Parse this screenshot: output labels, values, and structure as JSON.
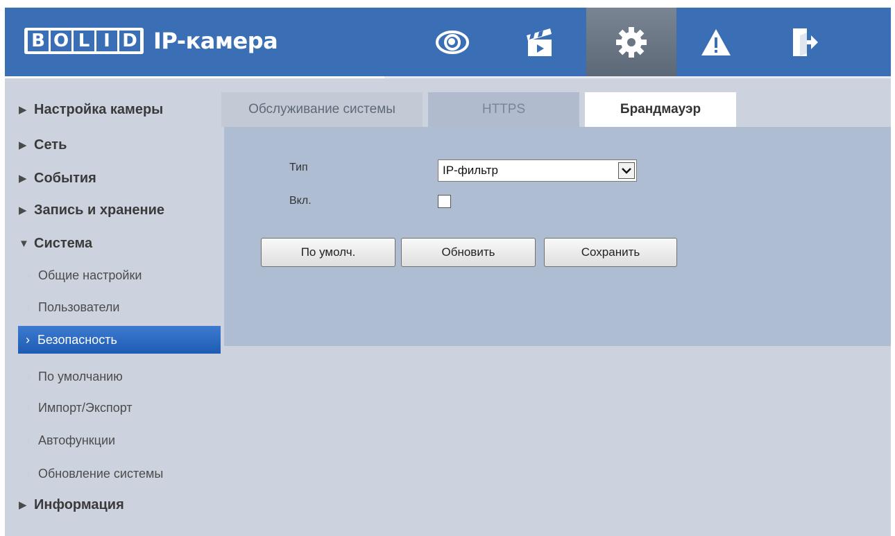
{
  "header": {
    "logo_letters": [
      "B",
      "O",
      "L",
      "I",
      "D"
    ],
    "product_title": "IP-камера",
    "nav": [
      {
        "icon": "eye-icon",
        "active": false
      },
      {
        "icon": "clapperboard-icon",
        "active": false
      },
      {
        "icon": "gear-icon",
        "active": true
      },
      {
        "icon": "warning-icon",
        "active": false
      },
      {
        "icon": "exit-icon",
        "active": false
      }
    ],
    "accent_color": "#3a6fb5"
  },
  "sidebar": {
    "top_items": [
      {
        "label": "Настройка камеры",
        "expanded": false
      },
      {
        "label": "Сеть",
        "expanded": false
      },
      {
        "label": "События",
        "expanded": false
      },
      {
        "label": "Запись и хранение",
        "expanded": false
      },
      {
        "label": "Система",
        "expanded": true
      },
      {
        "label": "Информация",
        "expanded": false
      }
    ],
    "system_sub_items": [
      {
        "label": "Общие настройки",
        "active": false
      },
      {
        "label": "Пользователи",
        "active": false
      },
      {
        "label": "Безопасность",
        "active": true
      },
      {
        "label": "По умолчанию",
        "active": false
      },
      {
        "label": "Импорт/Экспорт",
        "active": false
      },
      {
        "label": "Автофункции",
        "active": false
      },
      {
        "label": "Обновление системы",
        "active": false
      }
    ],
    "active_color": "#2a67c0"
  },
  "tabs": [
    {
      "label": "Обслуживание системы",
      "active": false
    },
    {
      "label": "HTTPS",
      "active": false
    },
    {
      "label": "Брандмауэр",
      "active": true
    }
  ],
  "form": {
    "type_label": "Тип",
    "type_value": "IP-фильтр",
    "enable_label": "Вкл.",
    "enable_checked": false
  },
  "buttons": {
    "default_label": "По умолч.",
    "refresh_label": "Обновить",
    "save_label": "Сохранить"
  }
}
